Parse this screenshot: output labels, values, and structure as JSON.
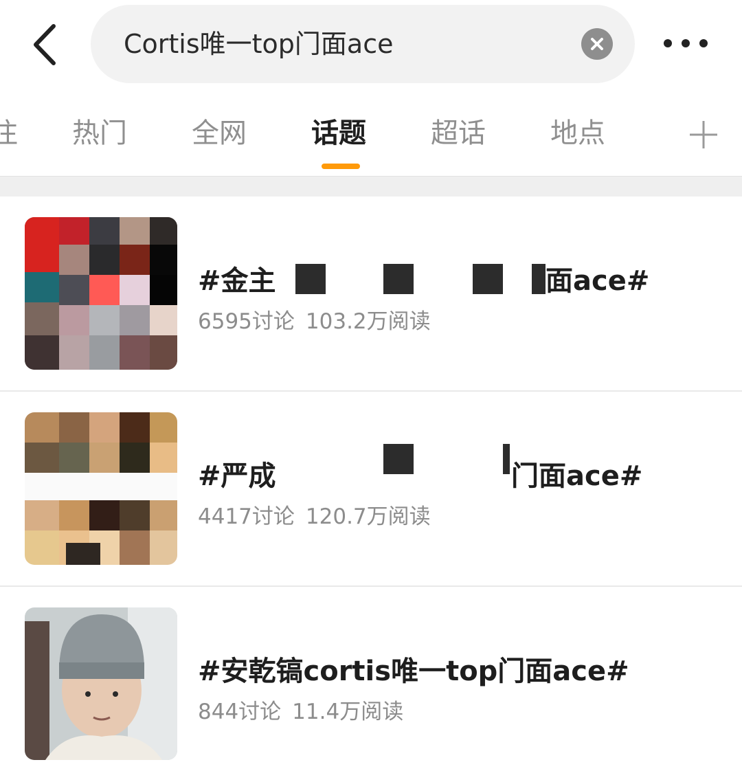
{
  "search": {
    "query": "Cortis唯一top门面ace"
  },
  "tabs": [
    {
      "label": "注"
    },
    {
      "label": "热门"
    },
    {
      "label": "全网"
    },
    {
      "label": "话题",
      "active": true
    },
    {
      "label": "超话"
    },
    {
      "label": "地点"
    }
  ],
  "topics": [
    {
      "title_start": "#金主",
      "title_end": "面ace#",
      "discussions": "6595讨论",
      "reads": "103.2万阅读"
    },
    {
      "title_start": "#严成",
      "title_end": "门面ace#",
      "discussions": "4417讨论",
      "reads": "120.7万阅读"
    },
    {
      "title": "#安乾镐cortis唯一top门面ace#",
      "discussions": "844讨论",
      "reads": "11.4万阅读"
    }
  ],
  "colors": {
    "accent": "#ff9a0a",
    "search_bg": "#f2f2f2",
    "muted_text": "#8c8c8c"
  },
  "icons": [
    "back-icon",
    "clear-icon",
    "more-icon",
    "add-icon"
  ]
}
